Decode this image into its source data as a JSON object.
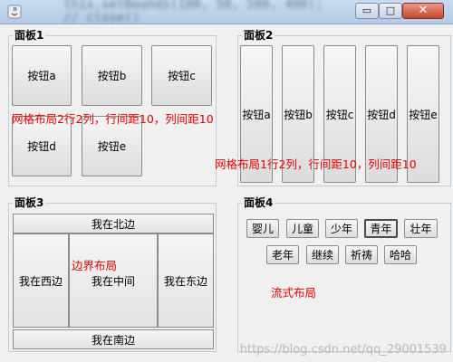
{
  "window": {
    "bg_code": "this.setBounds(100, 50, 500, 400);\n// close()",
    "min_glyph": "▭",
    "max_glyph": "□",
    "close_glyph": "✕"
  },
  "panel1": {
    "title": "面板1",
    "buttons": [
      "按钮a",
      "按钮b",
      "按钮c",
      "按钮d",
      "按钮e"
    ],
    "note": "网格布局2行2列，行间距10，列间距10"
  },
  "panel2": {
    "title": "面板2",
    "buttons": [
      "按钮a",
      "按钮b",
      "按钮c",
      "按钮d",
      "按钮e"
    ],
    "note": "网格布局1行2列，行间距10，列间距10"
  },
  "panel3": {
    "title": "面板3",
    "north": "我在北边",
    "west": "我在西边",
    "center": "我在中间",
    "east": "我在东边",
    "south": "我在南边",
    "note": "边界布局"
  },
  "panel4": {
    "title": "面板4",
    "buttons": [
      "婴儿",
      "儿童",
      "少年",
      "青年",
      "壮年",
      "老年",
      "继续",
      "祈祷",
      "哈哈"
    ],
    "note": "流式布局"
  },
  "watermark": "https://blog.csdn.net/qq_29001539",
  "colors": {
    "accent_note": "#e00000"
  }
}
